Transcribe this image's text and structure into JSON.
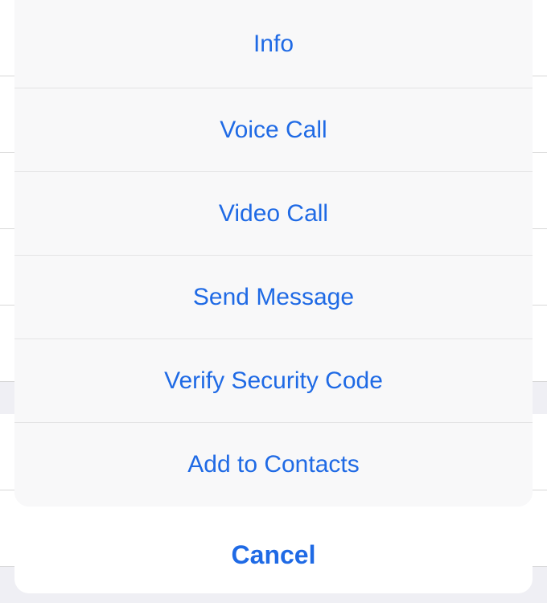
{
  "actionSheet": {
    "items": [
      {
        "label": "Info"
      },
      {
        "label": "Voice Call"
      },
      {
        "label": "Video Call"
      },
      {
        "label": "Send Message"
      },
      {
        "label": "Verify Security Code"
      },
      {
        "label": "Add to Contacts"
      }
    ],
    "cancelLabel": "Cancel"
  }
}
